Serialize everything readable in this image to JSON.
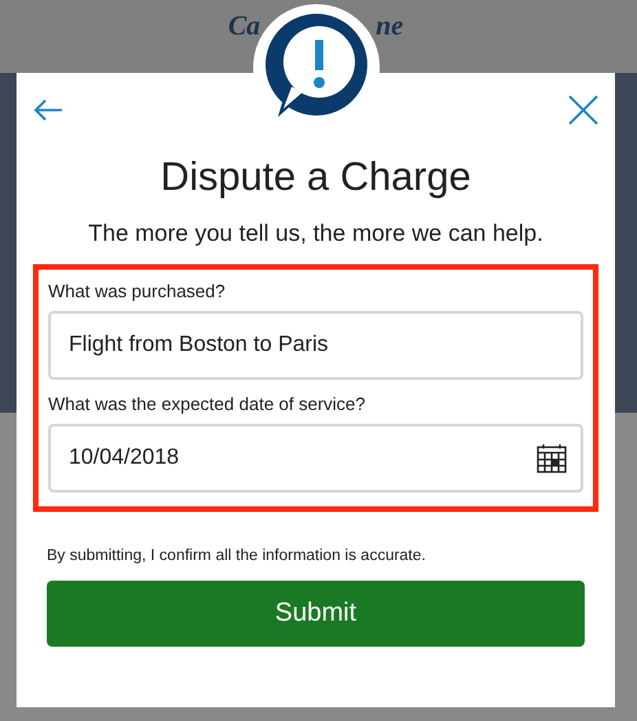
{
  "background_logo": {
    "left": "Ca",
    "right": "ne"
  },
  "dialog": {
    "title": "Dispute a Charge",
    "subtitle": "The more you tell us, the more we can help.",
    "fields": [
      {
        "kind": "text",
        "label": "What was purchased?",
        "value": "Flight from Boston to Paris"
      },
      {
        "kind": "date",
        "label": "What was the expected date of service?",
        "value": "10/04/2018"
      }
    ],
    "highlighted": true,
    "disclaimer": "By submitting, I confirm all the information is accurate.",
    "submit": "Submit"
  }
}
